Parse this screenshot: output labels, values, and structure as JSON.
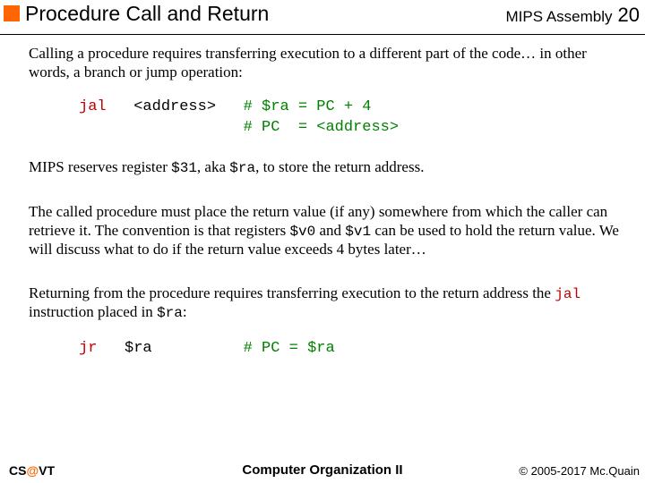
{
  "header": {
    "title": "Procedure Call and Return",
    "course_label": "MIPS Assembly",
    "slide_number": "20"
  },
  "body": {
    "para1": "Calling a procedure requires transferring execution to a different part of the code… in other words, a branch or jump operation:",
    "code1": {
      "mnemonic": "jal",
      "operand": "<address>",
      "comment_l1": "# $ra = PC + 4",
      "comment_l2": "# PC  = <address>"
    },
    "para2_pre": "MIPS reserves register ",
    "para2_reg31": "$31",
    "para2_mid": ", aka ",
    "para2_ra": "$ra",
    "para2_post": ", to store the return address.",
    "para3_pre": "The called procedure must place the return value (if any) somewhere from which the caller can retrieve it.  The convention is that registers ",
    "para3_v0": "$v0",
    "para3_mid": " and ",
    "para3_v1": "$v1",
    "para3_post": " can be used to hold the return value.  We will discuss what to do if the return value exceeds 4 bytes later…",
    "para4_pre": "Returning from the procedure requires transferring execution to the return address the ",
    "para4_jal": "jal",
    "para4_mid": " instruction placed in ",
    "para4_ra": "$ra",
    "para4_post": ":",
    "code2": {
      "mnemonic": "jr",
      "operand": "$ra",
      "comment": "# PC = $ra"
    }
  },
  "footer": {
    "left_cs": "CS",
    "left_at": "@",
    "left_vt": "VT",
    "center": "Computer Organization II",
    "right": "© 2005-2017 Mc.Quain"
  }
}
